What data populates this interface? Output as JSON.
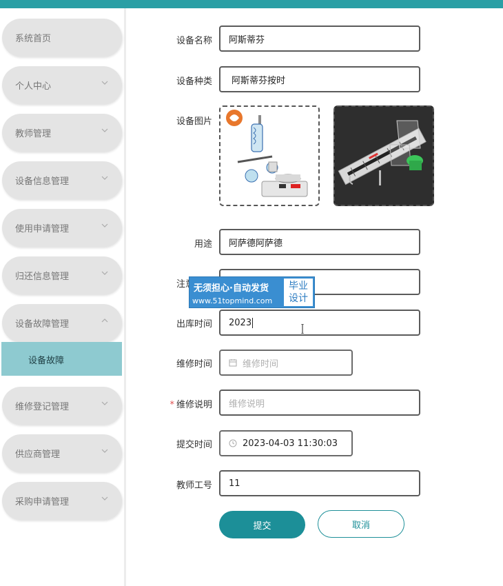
{
  "sidebar": {
    "items": [
      {
        "label": "系统首页"
      },
      {
        "label": "个人中心"
      },
      {
        "label": "教师管理"
      },
      {
        "label": "设备信息管理"
      },
      {
        "label": "使用申请管理"
      },
      {
        "label": "归还信息管理"
      },
      {
        "label": "设备故障管理"
      },
      {
        "label": "维修登记管理"
      },
      {
        "label": "供应商管理"
      },
      {
        "label": "采购申请管理"
      }
    ],
    "sub_item_label": "设备故障"
  },
  "form": {
    "name_label": "设备名称",
    "name_value": "阿斯蒂芬",
    "type_label": "设备种类",
    "type_value": "阿斯蒂芬按时",
    "image_label": "设备图片",
    "usage_label": "用途",
    "usage_value": "阿萨德阿萨德",
    "notes_label": "注意事项",
    "outbound_label": "出库时间",
    "outbound_value": "2023",
    "repair_time_label": "维修时间",
    "repair_time_placeholder": "维修时间",
    "repair_desc_label": "维修说明",
    "repair_desc_placeholder": "维修说明",
    "submit_time_label": "提交时间",
    "submit_time_value": "2023-04-03 11:30:03",
    "teacher_id_label": "教师工号",
    "teacher_id_value": "11",
    "submit_label": "提交",
    "cancel_label": "取消"
  },
  "watermark": {
    "line1": "无须担心·自动发货",
    "line2": "www.51topmind.com",
    "badge_line1": "毕业",
    "badge_line2": "设计"
  },
  "colors": {
    "accent": "#2a9fa5",
    "submit": "#1c8f98",
    "sidebar_active": "#8ecad0",
    "sidebar_pill": "#e4e4e4",
    "required_star": "#e05050"
  }
}
